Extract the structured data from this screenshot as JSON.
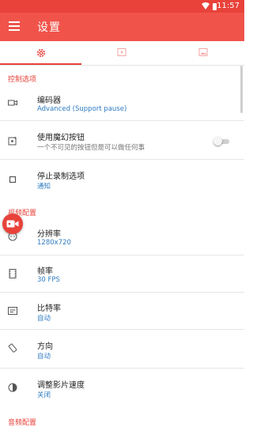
{
  "status_bar": {
    "time": "11:57"
  },
  "app_bar": {
    "title": "设置"
  },
  "tabs": [
    {
      "icon": "gear-icon",
      "active": true
    },
    {
      "icon": "video-icon",
      "active": false
    },
    {
      "icon": "image-icon",
      "active": false
    }
  ],
  "sections": [
    {
      "header": "控制选项"
    },
    {
      "header": "视频配置"
    },
    {
      "header": "音频配置"
    }
  ],
  "items": {
    "encoder": {
      "title": "编码器",
      "value": "Advanced (Support pause)",
      "icon": "camera-icon"
    },
    "magic_button": {
      "title": "使用魔幻按钮",
      "subtitle": "一个不可见的按钮但是可以做任何事",
      "icon": "magic-icon",
      "toggle_on": false
    },
    "stop_record": {
      "title": "停止录制选项",
      "value": "通知",
      "icon": "stop-icon"
    },
    "resolution": {
      "title": "分辨率",
      "value": "1280x720",
      "icon": "resolution-icon"
    },
    "frame_rate": {
      "title": "帧率",
      "value": "30 FPS",
      "icon": "filmstrip-icon"
    },
    "bitrate": {
      "title": "比特率",
      "value": "自动",
      "icon": "bitrate-icon"
    },
    "orientation": {
      "title": "方向",
      "value": "自动",
      "icon": "rotate-icon"
    },
    "speed": {
      "title": "调整影片速度",
      "value": "关闭",
      "icon": "timer-icon"
    }
  },
  "colors": {
    "accent": "#e8423a",
    "app_bar": "#f0534a",
    "link": "#2e7bc2"
  }
}
